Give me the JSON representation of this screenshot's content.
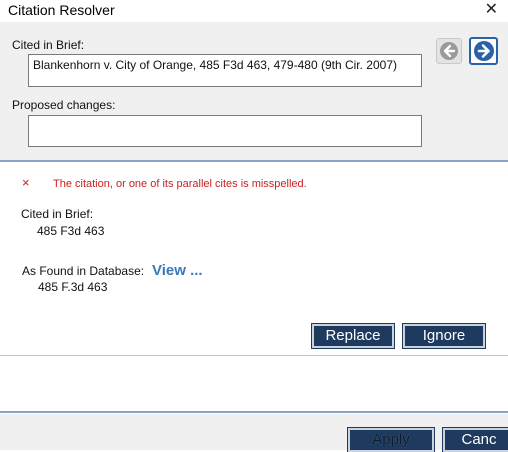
{
  "window": {
    "title": "Citation Resolver"
  },
  "form": {
    "cited_label": "Cited in Brief:",
    "cited_value": "Blankenhorn v. City of Orange, 485 F3d 463, 479-480 (9th Cir. 2007)",
    "proposed_label": "Proposed changes:",
    "proposed_value": ""
  },
  "result": {
    "error_icon": "×",
    "error_message": "The citation, or one of its parallel cites is misspelled.",
    "cited_label": "Cited in Brief:",
    "cited_value": "485 F3d 463",
    "found_label": "As Found in Database:",
    "found_value": "485 F.3d 463",
    "view_link": "View ..."
  },
  "buttons": {
    "replace": "Replace",
    "ignore": "Ignore",
    "apply": "Apply",
    "cancel": "Canc"
  },
  "icons": {
    "close": "close-icon",
    "back": "arrow-left-icon",
    "forward": "arrow-right-icon",
    "error": "error-x-icon"
  },
  "colors": {
    "error": "#cc2020",
    "link": "#3a78b8",
    "button_bg": "#1e3a5f",
    "nav_accent": "#2a62a8"
  }
}
